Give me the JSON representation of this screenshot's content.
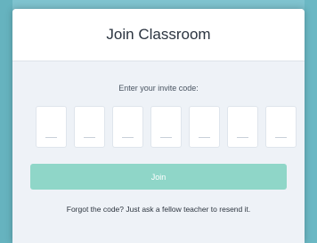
{
  "modal": {
    "title": "Join Classroom",
    "prompt": "Enter your invite code:",
    "code_length": 7,
    "join_label": "Join",
    "help_text": "Forgot the code? Just ask a fellow teacher to resend it."
  },
  "colors": {
    "backdrop": "#6bb8c4",
    "join_button": "#8fd6c8",
    "modal_body": "#eef2f7"
  }
}
